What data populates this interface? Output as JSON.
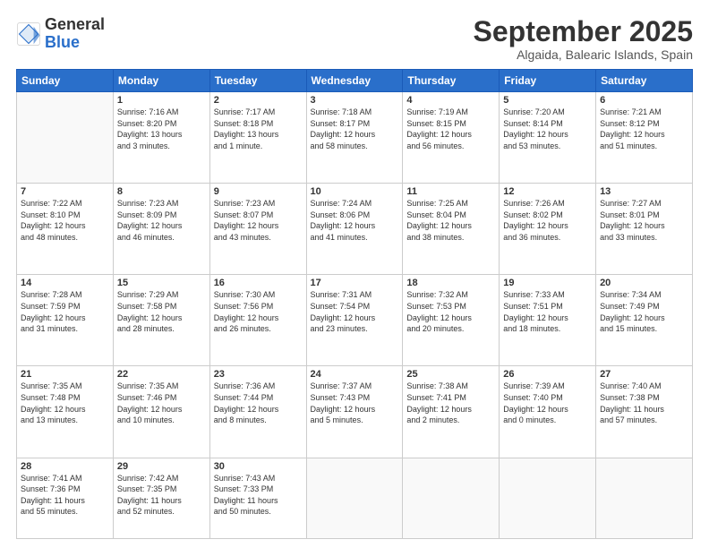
{
  "logo": {
    "general": "General",
    "blue": "Blue"
  },
  "header": {
    "month": "September 2025",
    "location": "Algaida, Balearic Islands, Spain"
  },
  "weekdays": [
    "Sunday",
    "Monday",
    "Tuesday",
    "Wednesday",
    "Thursday",
    "Friday",
    "Saturday"
  ],
  "weeks": [
    [
      {
        "day": "",
        "info": ""
      },
      {
        "day": "1",
        "info": "Sunrise: 7:16 AM\nSunset: 8:20 PM\nDaylight: 13 hours\nand 3 minutes."
      },
      {
        "day": "2",
        "info": "Sunrise: 7:17 AM\nSunset: 8:18 PM\nDaylight: 13 hours\nand 1 minute."
      },
      {
        "day": "3",
        "info": "Sunrise: 7:18 AM\nSunset: 8:17 PM\nDaylight: 12 hours\nand 58 minutes."
      },
      {
        "day": "4",
        "info": "Sunrise: 7:19 AM\nSunset: 8:15 PM\nDaylight: 12 hours\nand 56 minutes."
      },
      {
        "day": "5",
        "info": "Sunrise: 7:20 AM\nSunset: 8:14 PM\nDaylight: 12 hours\nand 53 minutes."
      },
      {
        "day": "6",
        "info": "Sunrise: 7:21 AM\nSunset: 8:12 PM\nDaylight: 12 hours\nand 51 minutes."
      }
    ],
    [
      {
        "day": "7",
        "info": "Sunrise: 7:22 AM\nSunset: 8:10 PM\nDaylight: 12 hours\nand 48 minutes."
      },
      {
        "day": "8",
        "info": "Sunrise: 7:23 AM\nSunset: 8:09 PM\nDaylight: 12 hours\nand 46 minutes."
      },
      {
        "day": "9",
        "info": "Sunrise: 7:23 AM\nSunset: 8:07 PM\nDaylight: 12 hours\nand 43 minutes."
      },
      {
        "day": "10",
        "info": "Sunrise: 7:24 AM\nSunset: 8:06 PM\nDaylight: 12 hours\nand 41 minutes."
      },
      {
        "day": "11",
        "info": "Sunrise: 7:25 AM\nSunset: 8:04 PM\nDaylight: 12 hours\nand 38 minutes."
      },
      {
        "day": "12",
        "info": "Sunrise: 7:26 AM\nSunset: 8:02 PM\nDaylight: 12 hours\nand 36 minutes."
      },
      {
        "day": "13",
        "info": "Sunrise: 7:27 AM\nSunset: 8:01 PM\nDaylight: 12 hours\nand 33 minutes."
      }
    ],
    [
      {
        "day": "14",
        "info": "Sunrise: 7:28 AM\nSunset: 7:59 PM\nDaylight: 12 hours\nand 31 minutes."
      },
      {
        "day": "15",
        "info": "Sunrise: 7:29 AM\nSunset: 7:58 PM\nDaylight: 12 hours\nand 28 minutes."
      },
      {
        "day": "16",
        "info": "Sunrise: 7:30 AM\nSunset: 7:56 PM\nDaylight: 12 hours\nand 26 minutes."
      },
      {
        "day": "17",
        "info": "Sunrise: 7:31 AM\nSunset: 7:54 PM\nDaylight: 12 hours\nand 23 minutes."
      },
      {
        "day": "18",
        "info": "Sunrise: 7:32 AM\nSunset: 7:53 PM\nDaylight: 12 hours\nand 20 minutes."
      },
      {
        "day": "19",
        "info": "Sunrise: 7:33 AM\nSunset: 7:51 PM\nDaylight: 12 hours\nand 18 minutes."
      },
      {
        "day": "20",
        "info": "Sunrise: 7:34 AM\nSunset: 7:49 PM\nDaylight: 12 hours\nand 15 minutes."
      }
    ],
    [
      {
        "day": "21",
        "info": "Sunrise: 7:35 AM\nSunset: 7:48 PM\nDaylight: 12 hours\nand 13 minutes."
      },
      {
        "day": "22",
        "info": "Sunrise: 7:35 AM\nSunset: 7:46 PM\nDaylight: 12 hours\nand 10 minutes."
      },
      {
        "day": "23",
        "info": "Sunrise: 7:36 AM\nSunset: 7:44 PM\nDaylight: 12 hours\nand 8 minutes."
      },
      {
        "day": "24",
        "info": "Sunrise: 7:37 AM\nSunset: 7:43 PM\nDaylight: 12 hours\nand 5 minutes."
      },
      {
        "day": "25",
        "info": "Sunrise: 7:38 AM\nSunset: 7:41 PM\nDaylight: 12 hours\nand 2 minutes."
      },
      {
        "day": "26",
        "info": "Sunrise: 7:39 AM\nSunset: 7:40 PM\nDaylight: 12 hours\nand 0 minutes."
      },
      {
        "day": "27",
        "info": "Sunrise: 7:40 AM\nSunset: 7:38 PM\nDaylight: 11 hours\nand 57 minutes."
      }
    ],
    [
      {
        "day": "28",
        "info": "Sunrise: 7:41 AM\nSunset: 7:36 PM\nDaylight: 11 hours\nand 55 minutes."
      },
      {
        "day": "29",
        "info": "Sunrise: 7:42 AM\nSunset: 7:35 PM\nDaylight: 11 hours\nand 52 minutes."
      },
      {
        "day": "30",
        "info": "Sunrise: 7:43 AM\nSunset: 7:33 PM\nDaylight: 11 hours\nand 50 minutes."
      },
      {
        "day": "",
        "info": ""
      },
      {
        "day": "",
        "info": ""
      },
      {
        "day": "",
        "info": ""
      },
      {
        "day": "",
        "info": ""
      }
    ]
  ]
}
